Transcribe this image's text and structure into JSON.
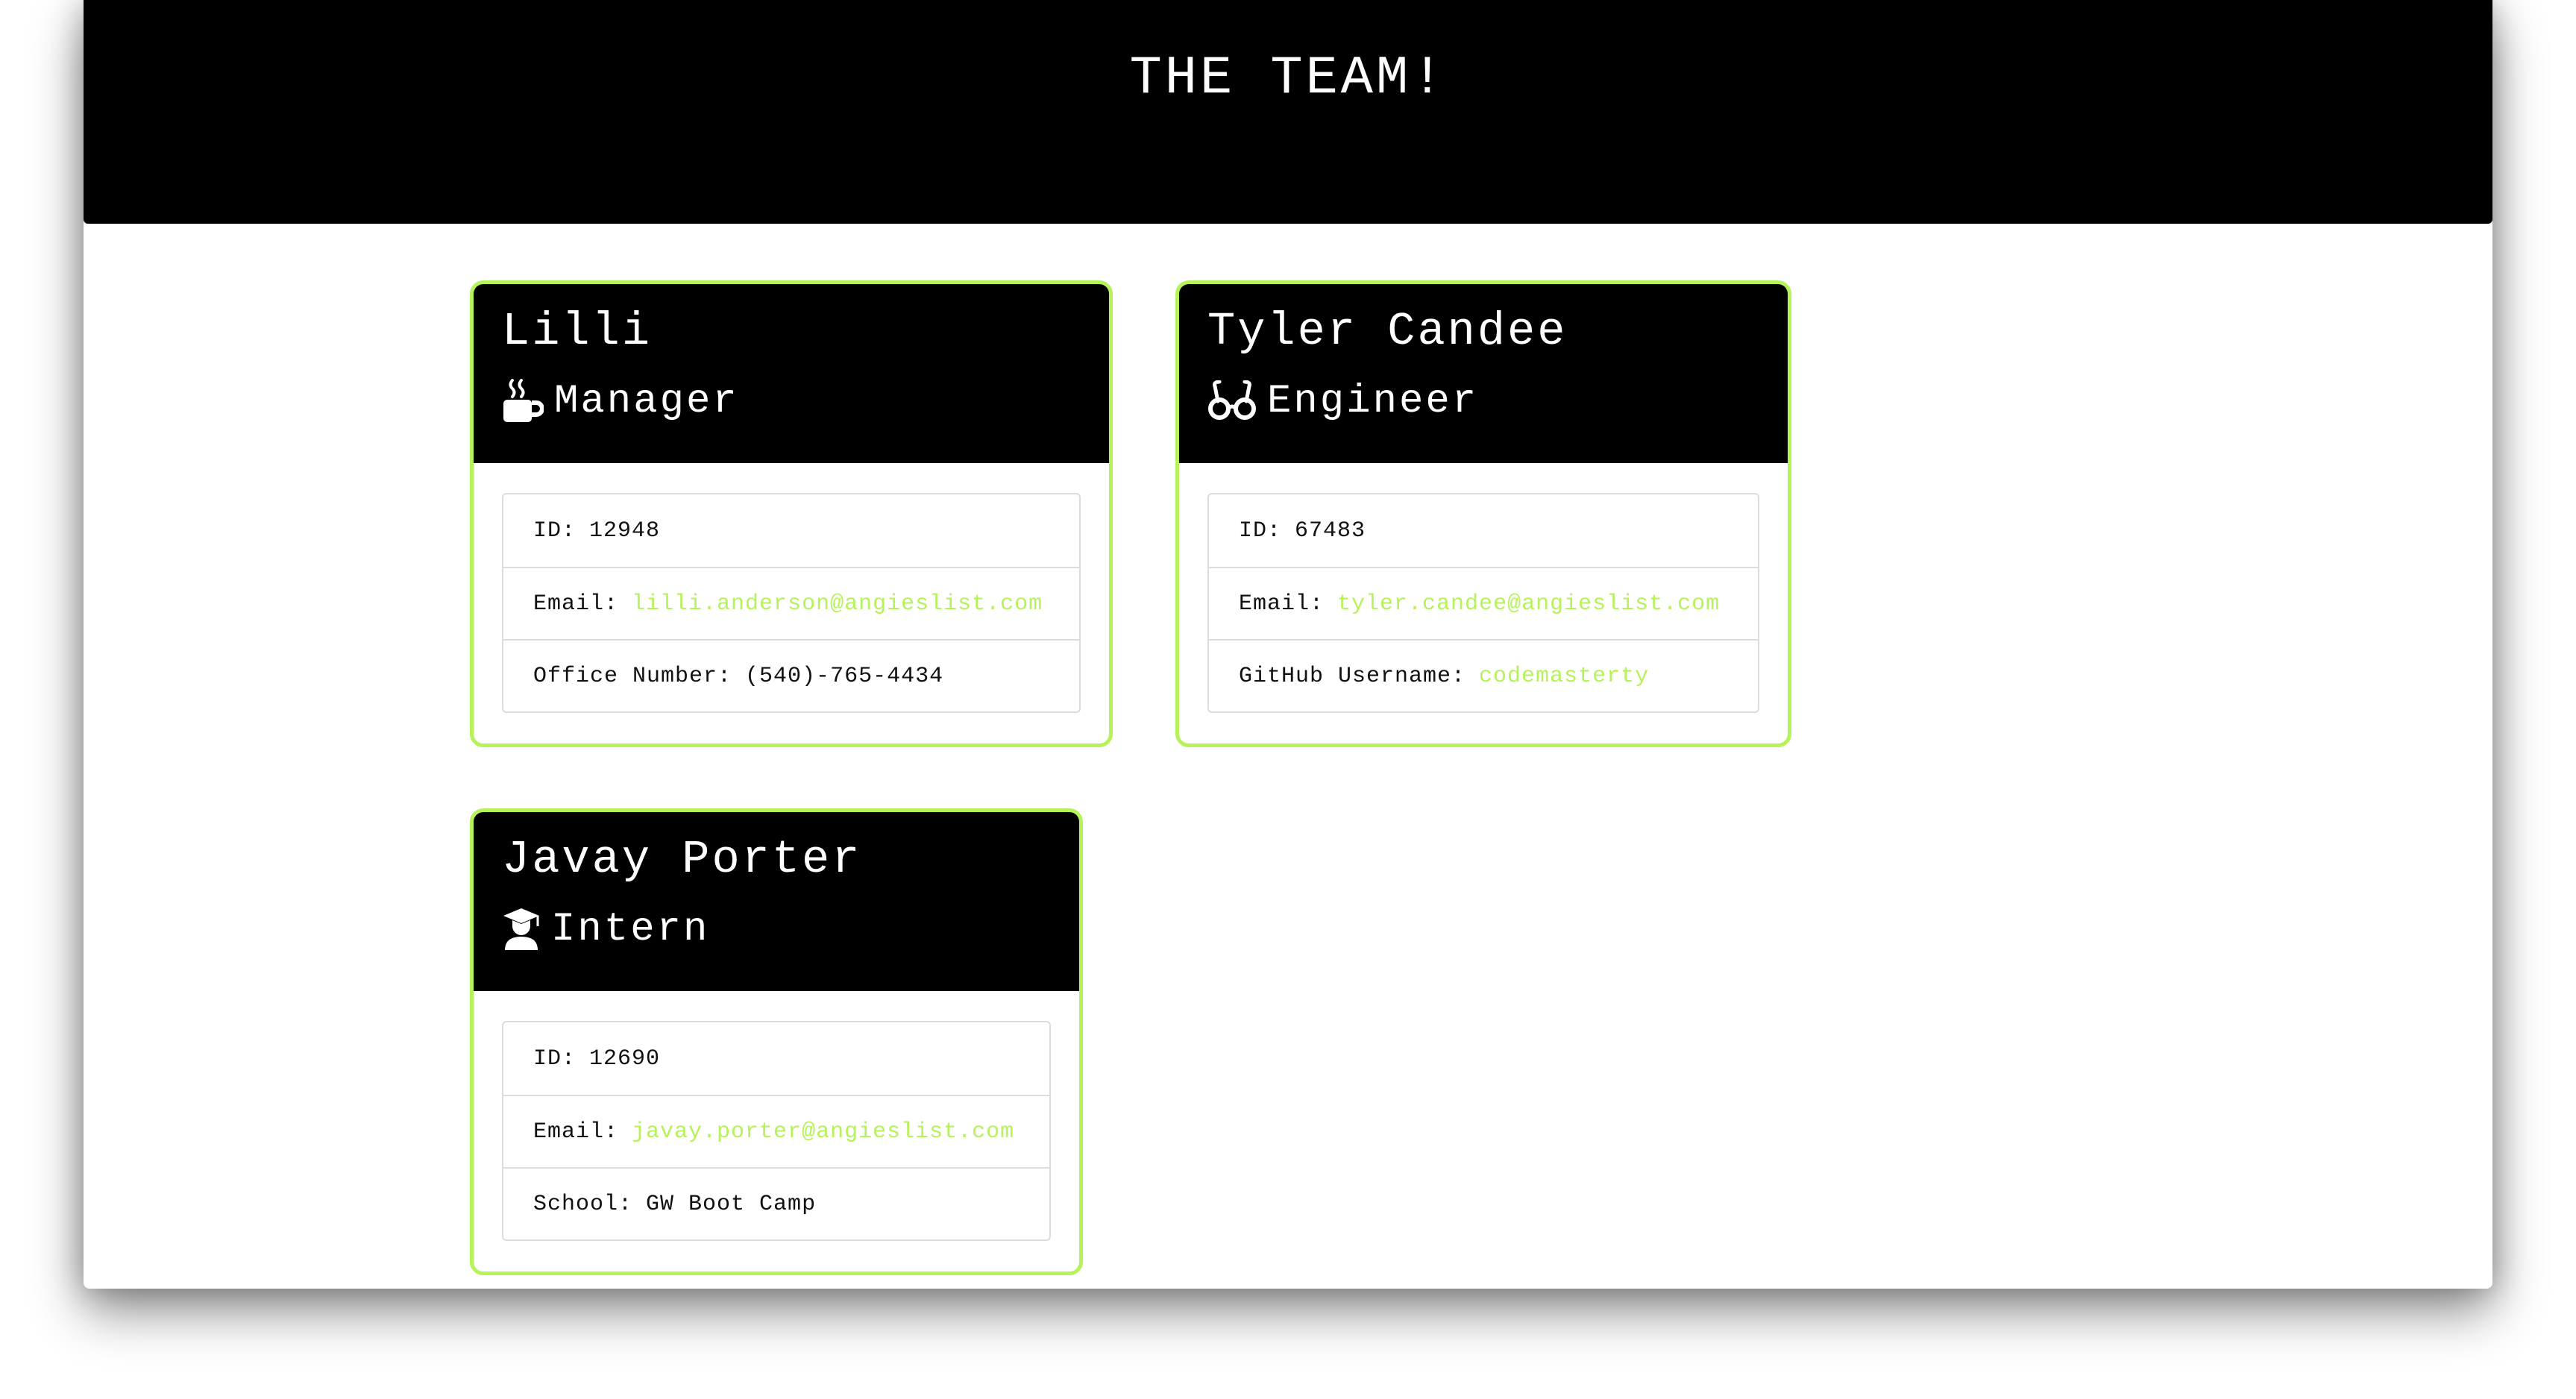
{
  "header": {
    "title": "THE TEAM!"
  },
  "colors": {
    "accent": "#b6f25a",
    "header_bg": "#000000"
  },
  "cards": [
    {
      "name": "Lilli",
      "role": "Manager",
      "role_icon": "coffee-icon",
      "id_label": "ID:",
      "id_value": "12948",
      "email_label": "Email:",
      "email_value": "lilli.anderson@angieslist.com",
      "extra_label": "Office Number:",
      "extra_value": "(540)-765-4434"
    },
    {
      "name": "Tyler Candee",
      "role": "Engineer",
      "role_icon": "glasses-icon",
      "id_label": "ID:",
      "id_value": "67483",
      "email_label": "Email:",
      "email_value": "tyler.candee@angieslist.com",
      "extra_label": "GitHub Username:",
      "extra_value": "codemasterty"
    },
    {
      "name": "Javay Porter",
      "role": "Intern",
      "role_icon": "graduate-icon",
      "id_label": "ID:",
      "id_value": "12690",
      "email_label": "Email:",
      "email_value": "javay.porter@angieslist.com",
      "extra_label": "School:",
      "extra_value": "GW Boot Camp"
    }
  ]
}
